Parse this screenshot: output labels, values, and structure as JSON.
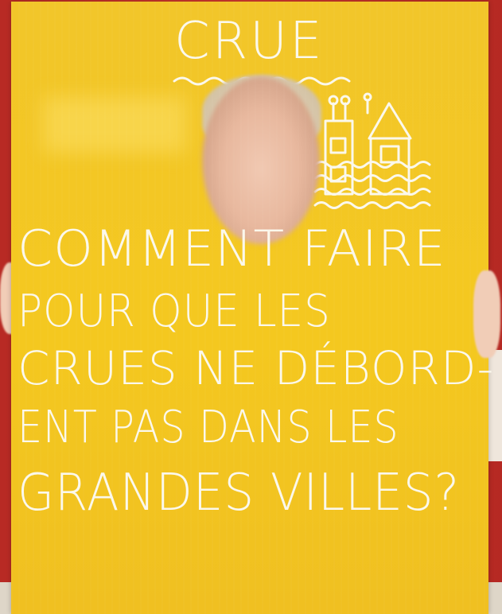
{
  "sign": {
    "title": "CRUE",
    "lines": [
      "COMMENT FAIRE",
      "POUR QUE LES",
      "CRUES NE DÉBORD-",
      "ENT PAS DANS LES",
      "GRANDES VILLES?"
    ]
  },
  "colors": {
    "background_wall": "#c8322a",
    "board": "#f2c62a",
    "chalk": "#fbf8ec"
  },
  "icons": [
    "flooded-house-drawing",
    "wave-underline"
  ]
}
